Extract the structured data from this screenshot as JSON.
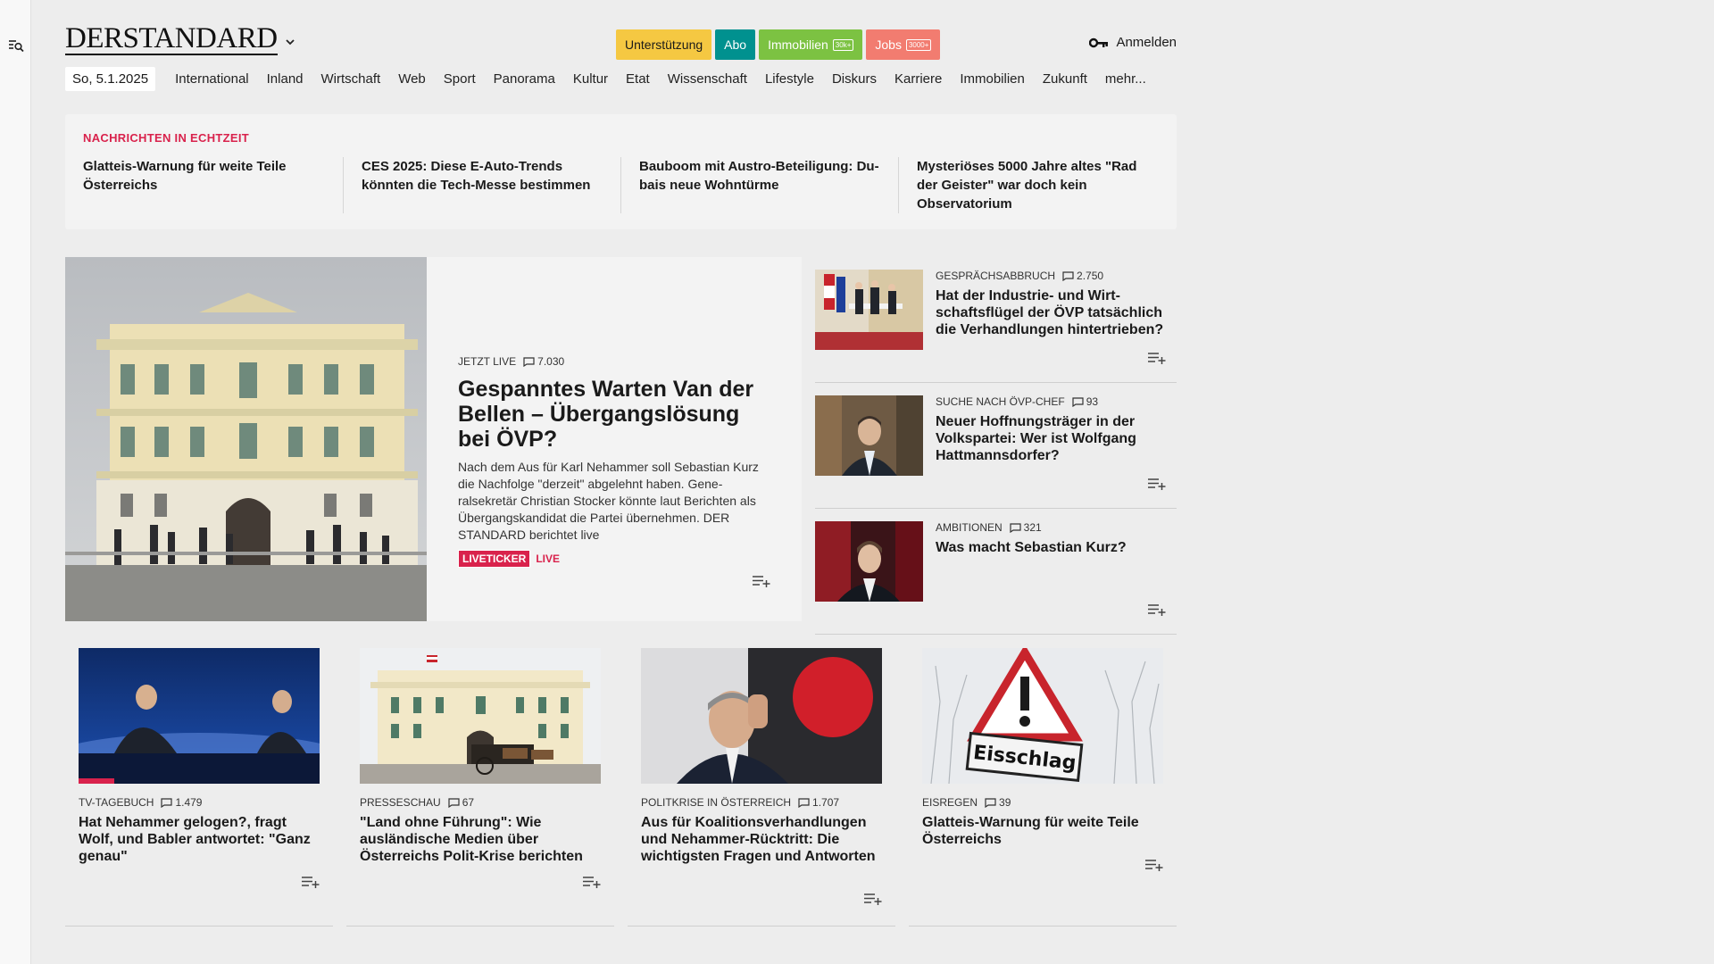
{
  "header": {
    "logo": "DERSTANDARD",
    "pills": [
      {
        "label": "Unterstützung",
        "bg": "#f5c842",
        "fg": "#1a1a1a",
        "badge": ""
      },
      {
        "label": "Abo",
        "bg": "#00918f",
        "fg": "#ffffff",
        "badge": ""
      },
      {
        "label": "Immobilien",
        "bg": "#7cc242",
        "fg": "#ffffff",
        "badge": "30k+"
      },
      {
        "label": "Jobs",
        "bg": "#f27c70",
        "fg": "#ffffff",
        "badge": "3000+"
      }
    ],
    "login": "Anmelden"
  },
  "nav": {
    "date": "So, 5.1.2025",
    "items": [
      "International",
      "Inland",
      "Wirtschaft",
      "Web",
      "Sport",
      "Panorama",
      "Kultur",
      "Etat",
      "Wissenschaft",
      "Lifestyle",
      "Diskurs",
      "Karriere",
      "Immobilien",
      "Zukunft",
      "mehr..."
    ]
  },
  "realtime": {
    "title": "NACHRICHTEN IN ECHTZEIT",
    "items": [
      "Glatteis-Warnung für weite Teile Österreichs",
      "CES 2025: Diese E-Auto-Trends könn­ten die Tech-Messe bestimmen",
      "Bauboom mit Austro-Beteiligung: Du­bais neue Wohntürme",
      "Mysteriöses 5000 Jahre altes \"Rad der Geister\" war doch kein Observatorium"
    ]
  },
  "hero": {
    "kicker": "JETZT LIVE",
    "comments": "7.030",
    "title": "Gespanntes Warten Van der Bellen – Übergangslösung bei ÖVP?",
    "lead": "Nach dem Aus für Karl Nehammer soll Sebastian Kurz die Nachfolge \"derzeit\" abgelehnt haben. Gene­ralsekretär Christian Stocker könnte laut Berichten als Übergangskandidat die Partei übernehmen. DER STANDARD berichtet live",
    "tag1": "LIVETICKER",
    "tag2": "LIVE"
  },
  "side": [
    {
      "kicker": "GESPRÄCHSABBRUCH",
      "comments": "2.750",
      "title": "Hat der Industrie- und Wirt­schaftsflügel der ÖVP tatsächlich die Verhandlungen hintertrieben?"
    },
    {
      "kicker": "SUCHE NACH ÖVP-CHEF",
      "comments": "93",
      "title": "Neuer Hoffnungsträger in der Volkspartei: Wer ist Wolfgang Hattmannsdorfer?"
    },
    {
      "kicker": "AMBITIONEN",
      "comments": "321",
      "title": "Was macht Sebastian Kurz?"
    }
  ],
  "cards": [
    {
      "kicker": "TV-TAGEBUCH",
      "comments": "1.479",
      "title": "Hat Nehammer gelogen?, fragt Wolf, und Babler antwortet: \"Ganz genau\""
    },
    {
      "kicker": "PRESSESCHAU",
      "comments": "67",
      "title": "\"Land ohne Führung\": Wie ausländische Medien über Österreichs Polit-Krise berichten"
    },
    {
      "kicker": "POLITKRISE IN ÖSTERREICH",
      "comments": "1.707",
      "title": "Aus für Koalitionsverhandlungen und Nehammer-Rücktritt: Die wichtigsten Fragen und Antworten"
    },
    {
      "kicker": "EISREGEN",
      "comments": "39",
      "title": "Glatteis-Warnung für weite Teile Österreichs",
      "sign": "Eisschlag"
    }
  ]
}
